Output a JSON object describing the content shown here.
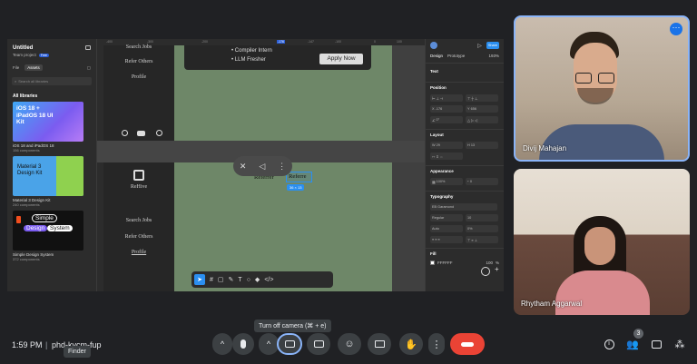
{
  "meeting": {
    "time": "1:59 PM",
    "separator": "|",
    "code": "phd-kvcm-fup",
    "finder_tooltip": "Finder",
    "camera_tooltip": "Turn off camera (⌘ + e)",
    "participant_count": "3"
  },
  "participants": [
    {
      "name": "Divij Mahajan"
    },
    {
      "name": "Rhytham Aggarwal"
    }
  ],
  "figma": {
    "file_title": "Untitled",
    "team": "Team project",
    "plan_badge": "Free",
    "tabs": [
      "File",
      "Assets"
    ],
    "search_placeholder": "Search all libraries",
    "libraries_header": "All libraries",
    "libraries": [
      {
        "name": "iOS 18 and iPadOS 18",
        "count": "156 components",
        "card_text": "iOS 18 + iPadOS 18 UI Kit"
      },
      {
        "name": "Material 3 Design Kit",
        "count": "240 components",
        "card_text": "Material 3 Design Kit"
      },
      {
        "name": "Simple Design System",
        "count": "372 components",
        "card_text_1": "Simple",
        "card_text_2": "Design",
        "card_text_3": "System"
      }
    ],
    "ruler_marks": [
      "-400",
      "-300",
      "-200",
      "-176",
      "-147",
      "-100",
      "0",
      "100",
      "200"
    ],
    "canvas": {
      "nav_top": [
        "Search Jobs",
        "Refer Others",
        "Profile"
      ],
      "nav_bottom": [
        "Search Jobs",
        "Refer Others",
        "Profile"
      ],
      "brand": "ReHive",
      "jobs": [
        "Compiler Intern",
        "LLM Fresher"
      ],
      "apply_button": "Apply Now",
      "refer_label_1": "Referrer",
      "refer_label_2": "Referre",
      "size_badge": "36 × 13"
    },
    "right": {
      "tabs": [
        "Design",
        "Prototype"
      ],
      "zoom": "193%",
      "share": "Share",
      "text_section": "Text",
      "position": "Position",
      "x": "-176",
      "y": "656",
      "rotation": "0°",
      "layout": "Layout",
      "w": "29",
      "h": "13",
      "appearance": "Appearance",
      "opacity": "100%",
      "radius": "0",
      "typography": "Typography",
      "font": "EB Garamond",
      "weight": "Regular",
      "size": "10",
      "line_height": "Auto",
      "letter_spacing": "0%",
      "fill": "Fill",
      "fill_hex": "FFFFFF",
      "fill_opacity": "100",
      "fill_pct": "%"
    }
  },
  "colors": {
    "end_call": "#ea4335",
    "meet_bg": "#202124",
    "canvas_green": "#6e8768",
    "accent_blue": "#1a73e8"
  }
}
